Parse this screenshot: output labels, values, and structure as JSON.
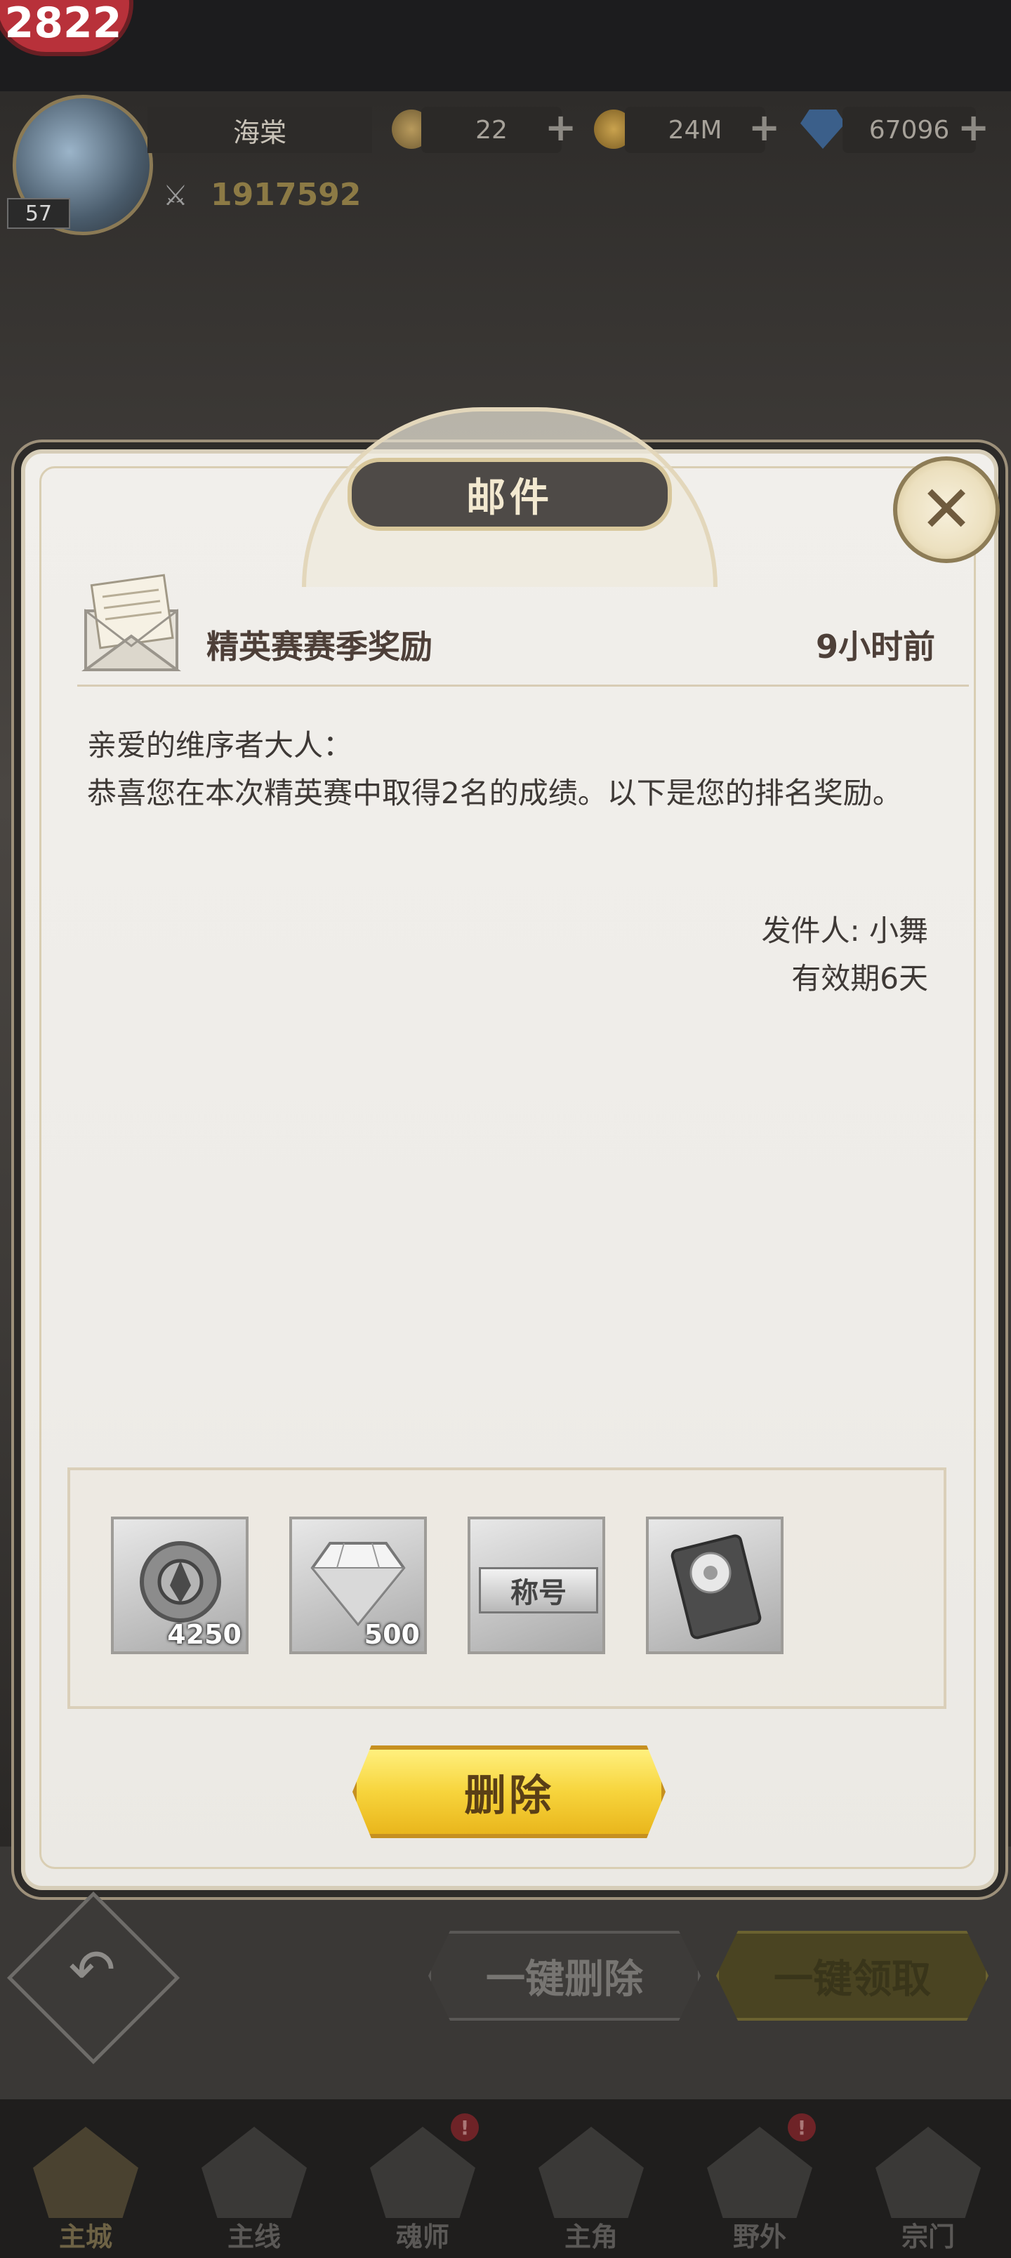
{
  "header": {
    "badge_text": "2822",
    "player_name": "海棠",
    "level": "57",
    "power": "1917592",
    "resources": [
      {
        "icon": "coin-token-icon",
        "value": "22"
      },
      {
        "icon": "gold-coin-icon",
        "value": "24M"
      },
      {
        "icon": "diamond-icon",
        "value": "67096"
      }
    ],
    "plus": "+"
  },
  "modal": {
    "title": "邮件",
    "close_symbol": "✕",
    "mail": {
      "subject": "精英赛赛季奖励",
      "time": "9小时前",
      "greeting": "亲爱的维序者大人：",
      "body": "恭喜您在本次精英赛中取得2名的成绩。以下是您的排名奖励。",
      "sender": "发件人: 小舞",
      "expire": "有效期6天"
    },
    "rewards": [
      {
        "icon": "emblem-icon",
        "count": "4250"
      },
      {
        "icon": "diamond-icon",
        "count": "500"
      },
      {
        "icon": "title-badge-icon",
        "label": "称号",
        "count": ""
      },
      {
        "icon": "card-icon",
        "count": ""
      }
    ],
    "delete_label": "删除"
  },
  "actions": {
    "back_symbol": "↶",
    "bulk_delete": "一键删除",
    "bulk_claim": "一键领取"
  },
  "nav": [
    {
      "label": "主城",
      "alert": false
    },
    {
      "label": "主线",
      "alert": false
    },
    {
      "label": "魂师",
      "alert": true
    },
    {
      "label": "主角",
      "alert": false
    },
    {
      "label": "野外",
      "alert": true
    },
    {
      "label": "宗门",
      "alert": false
    }
  ],
  "nav_alert_symbol": "!"
}
